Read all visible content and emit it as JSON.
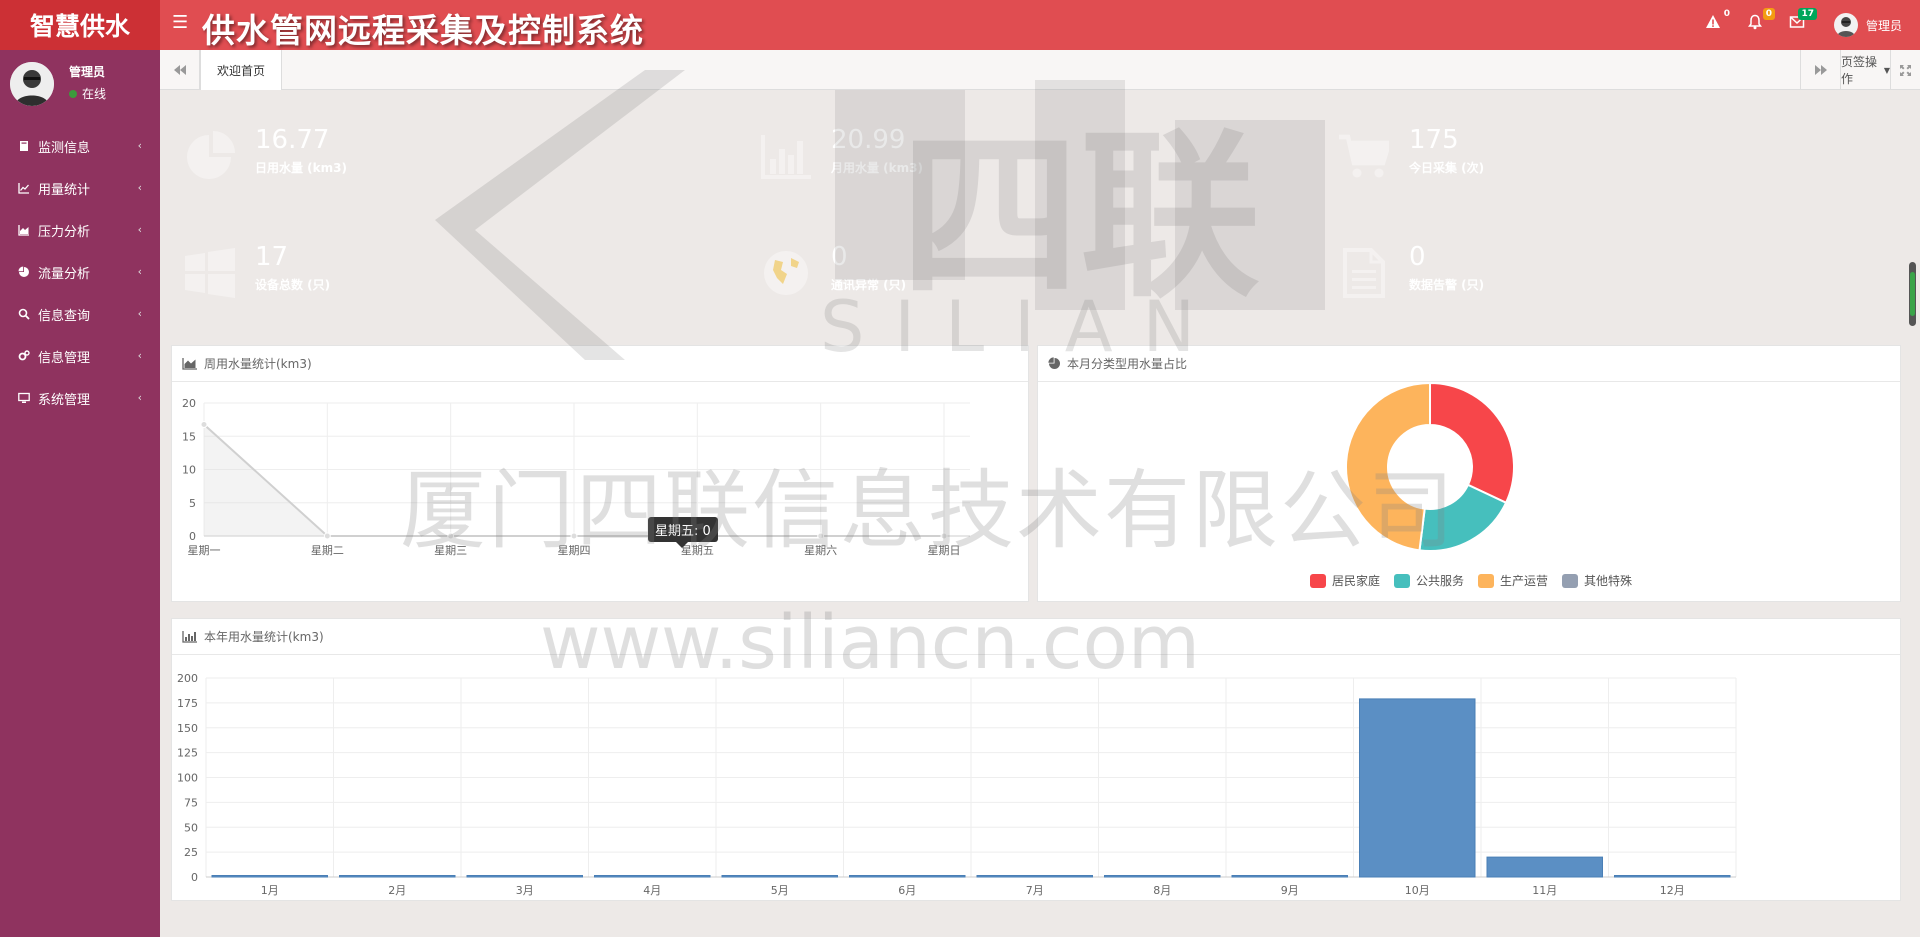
{
  "header": {
    "logo": "智慧供水",
    "system_title": "供水管网远程采集及控制系统",
    "user_name": "管理员",
    "badges": {
      "warning": "0",
      "bell": "0",
      "mail": "17"
    }
  },
  "sidebar": {
    "user_name": "管理员",
    "status": "在线",
    "items": [
      {
        "label": "监测信息",
        "icon": "book-icon"
      },
      {
        "label": "用量统计",
        "icon": "line-chart-icon"
      },
      {
        "label": "压力分析",
        "icon": "area-chart-icon"
      },
      {
        "label": "流量分析",
        "icon": "pie-chart-icon"
      },
      {
        "label": "信息查询",
        "icon": "search-icon"
      },
      {
        "label": "信息管理",
        "icon": "cogs-icon"
      },
      {
        "label": "系统管理",
        "icon": "desktop-icon"
      }
    ]
  },
  "tabs": {
    "active": "欢迎首页",
    "page_ops": "页签操作"
  },
  "stats": [
    {
      "value": "16.77",
      "label": "日用水量 (km3)",
      "color": "#5b8fc4",
      "icon": "pie-chart-icon"
    },
    {
      "value": "20.99",
      "label": "月用水量 (km3)",
      "color": "#2e8b2e",
      "icon": "bar-chart-icon"
    },
    {
      "value": "175",
      "label": "今日采集 (次)",
      "color": "#4f5e69",
      "icon": "cart-icon"
    },
    {
      "value": "17",
      "label": "设备总数 (只)",
      "color": "#45b5ad",
      "icon": "windows-icon"
    },
    {
      "value": "0",
      "label": "通讯异常 (只)",
      "color": "#f7b500",
      "icon": "globe-icon"
    },
    {
      "value": "0",
      "label": "数据告警 (只)",
      "color": "#fa4a04",
      "icon": "file-icon"
    }
  ],
  "charts": {
    "weekly_title": "周用水量统计(km3)",
    "category_title": "本月分类型用水量占比",
    "yearly_title": "本年用水量统计(km3)",
    "tooltip": "星期五: 0"
  },
  "chart_data": [
    {
      "type": "area",
      "title": "周用水量统计(km3)",
      "categories": [
        "星期一",
        "星期二",
        "星期三",
        "星期四",
        "星期五",
        "星期六",
        "星期日"
      ],
      "values": [
        16.77,
        0,
        0,
        0,
        0,
        0,
        0
      ],
      "ylim": [
        0,
        20
      ],
      "yticks": [
        0,
        5,
        10,
        15,
        20
      ],
      "grid": true
    },
    {
      "type": "pie",
      "title": "本月分类型用水量占比",
      "donut": true,
      "labels": [
        "居民家庭",
        "公共服务",
        "生产运营",
        "其他特殊"
      ],
      "values": [
        32,
        20,
        48,
        0
      ],
      "colors": [
        "#f7464a",
        "#46bfbd",
        "#fdb45c",
        "#949fb1"
      ],
      "legend": "bottom"
    },
    {
      "type": "bar",
      "title": "本年用水量统计(km3)",
      "categories": [
        "1月",
        "2月",
        "3月",
        "4月",
        "5月",
        "6月",
        "7月",
        "8月",
        "9月",
        "10月",
        "11月",
        "12月"
      ],
      "values": [
        0,
        0,
        0,
        0,
        0,
        0,
        0,
        0,
        0,
        179,
        20,
        0
      ],
      "ylim": [
        0,
        200
      ],
      "yticks": [
        0,
        25,
        50,
        75,
        100,
        125,
        150,
        175,
        200
      ],
      "color": "#5b8fc4",
      "grid": true
    }
  ],
  "watermark": {
    "company": "厦门四联信息技术有限公司",
    "url": "www.siliancn.com",
    "brand": "四联",
    "brand_en": "SILIAN"
  }
}
